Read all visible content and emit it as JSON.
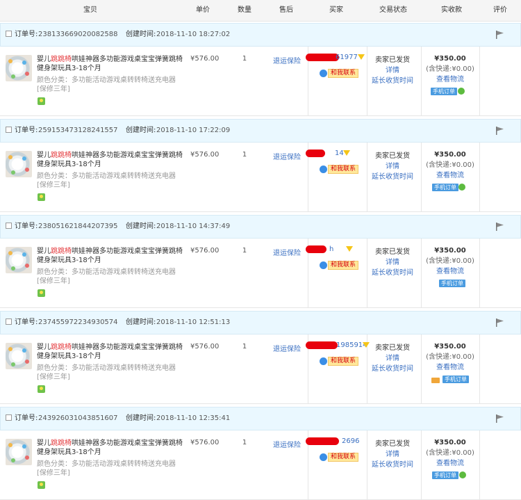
{
  "header": {
    "cols": [
      "宝贝",
      "单价",
      "数量",
      "售后",
      "买家",
      "交易状态",
      "实收款",
      "评价"
    ]
  },
  "labels": {
    "order_no": "订单号:",
    "created": "创建时间:",
    "title_pre": "婴儿",
    "title_hl": "跳跳椅",
    "title_post": "哄娃神器多功能游戏桌宝宝弹簧跳椅健身架玩具3-18个月",
    "spec": "颜色分类：多功能活动游戏桌转转椅送充电器[保修三年]",
    "after_sale": "退运保险",
    "contact": "和我联系",
    "status_shipped": "卖家已发货",
    "detail": "详情",
    "extend": "延长收货时间",
    "shipping_fee": "(含快递:¥0.00)",
    "logistics": "查看物流",
    "mobile_order": "手机订单"
  },
  "orders": [
    {
      "order_no": "2381336690200825​88",
      "created_time": "2018-11-10 18:27:02",
      "price": "¥576.00",
      "qty": "1",
      "buyer_suffix": "61977",
      "amount": "¥350.00"
    },
    {
      "order_no": "259153473128241557",
      "created_time": "2018-11-10 17:22:09",
      "price": "¥576.00",
      "qty": "1",
      "buyer_suffix": "14",
      "amount": "¥350.00"
    },
    {
      "order_no": "238051621844207395",
      "created_time": "2018-11-10 14:37:49",
      "price": "¥576.00",
      "qty": "1",
      "buyer_suffix": "h",
      "amount": "¥350.00"
    },
    {
      "order_no": "237455972234930574",
      "created_time": "2018-11-10 12:51:13",
      "price": "¥576.00",
      "qty": "1",
      "buyer_suffix": "1985914",
      "amount": "¥350.00"
    },
    {
      "order_no": "243926031043851607",
      "created_time": "2018-11-10 12:35:41",
      "price": "¥576.00",
      "qty": "1",
      "buyer_suffix": "2696",
      "amount": "¥350.00"
    }
  ],
  "icons": {
    "flag": "flag-icon",
    "filter": "funnel-icon",
    "wangwang": "chat-icon",
    "mobile": "mobile-icon",
    "green": "refresh-icon",
    "card": "card-icon"
  },
  "colors": {
    "accent_blue": "#3a6fc1",
    "highlight_red": "#e4393c",
    "order_bar_bg": "#eaf8ff"
  }
}
